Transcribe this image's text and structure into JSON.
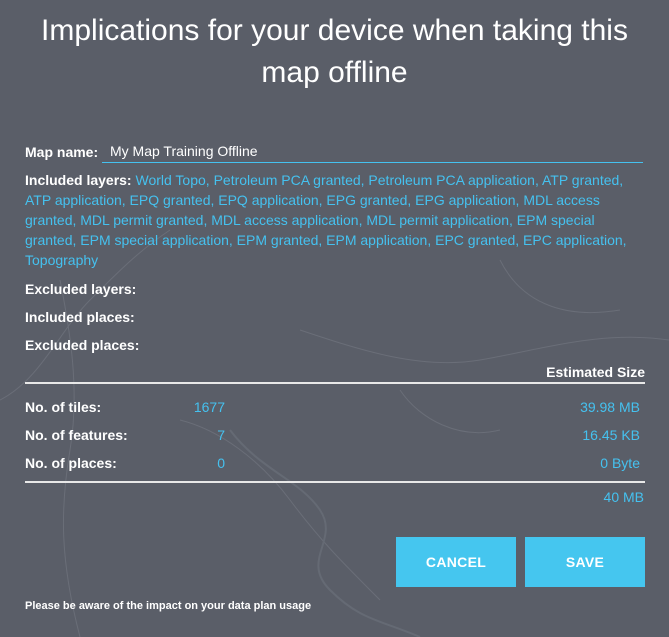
{
  "dialog": {
    "title": "Implications for your device when taking this map offline",
    "map_name_label": "Map name:",
    "map_name_value": "My Map Training Offline",
    "included_layers_label": "Included layers:",
    "included_layers_value": "World Topo, Petroleum PCA granted, Petroleum PCA application, ATP granted, ATP application, EPQ granted, EPQ application, EPG granted, EPG application, MDL access granted, MDL permit granted, MDL access application, MDL permit application, EPM special granted, EPM special application, EPM granted, EPM application, EPC granted, EPC application, Topography",
    "excluded_layers_label": "Excluded layers:",
    "included_places_label": "Included places:",
    "excluded_places_label": "Excluded places:",
    "estimated_size_header": "Estimated Size",
    "stats": [
      {
        "label": "No. of tiles:",
        "count": "1677",
        "size": "39.98 MB"
      },
      {
        "label": "No. of features:",
        "count": "7",
        "size": "16.45 KB"
      },
      {
        "label": "No. of places:",
        "count": "0",
        "size": "0 Byte"
      }
    ],
    "total_size": "40 MB",
    "cancel_label": "CANCEL",
    "save_label": "SAVE",
    "footnote": "Please be aware of the impact on your data plan usage"
  },
  "colors": {
    "background": "#5a5e68",
    "accent": "#45c1ef",
    "button": "#45c6ef",
    "text": "#ffffff"
  }
}
